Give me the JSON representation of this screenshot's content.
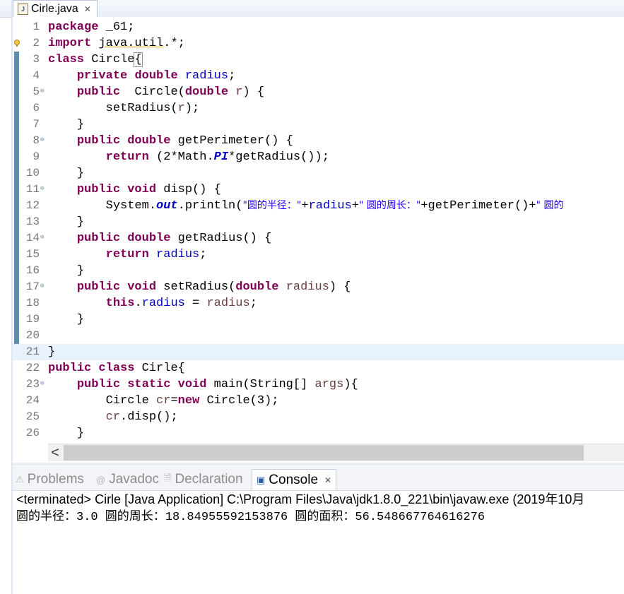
{
  "editor_tab": {
    "title": "Cirle.java",
    "icon": "java-file-icon"
  },
  "code_lines": [
    [
      {
        "t": "package",
        "c": "kw"
      },
      {
        "t": " _61;"
      }
    ],
    [
      {
        "t": "import",
        "c": "kw"
      },
      {
        "t": " "
      },
      {
        "t": "java.util",
        "c": "underline"
      },
      {
        "t": ".*;"
      }
    ],
    [
      {
        "t": "class",
        "c": "kw"
      },
      {
        "t": " Circle"
      },
      {
        "t": "{",
        "c": "bracket-box"
      }
    ],
    [
      {
        "t": "    "
      },
      {
        "t": "private",
        "c": "kw"
      },
      {
        "t": " "
      },
      {
        "t": "double",
        "c": "kw"
      },
      {
        "t": " "
      },
      {
        "t": "radius",
        "c": "fld"
      },
      {
        "t": ";"
      }
    ],
    [
      {
        "t": "    "
      },
      {
        "t": "public",
        "c": "kw"
      },
      {
        "t": "  Circle("
      },
      {
        "t": "double",
        "c": "kw"
      },
      {
        "t": " "
      },
      {
        "t": "r",
        "c": "var"
      },
      {
        "t": ") {"
      }
    ],
    [
      {
        "t": "        setRadius("
      },
      {
        "t": "r",
        "c": "var"
      },
      {
        "t": ");"
      }
    ],
    [
      {
        "t": "    }"
      }
    ],
    [
      {
        "t": "    "
      },
      {
        "t": "public",
        "c": "kw"
      },
      {
        "t": " "
      },
      {
        "t": "double",
        "c": "kw"
      },
      {
        "t": " getPerimeter() {"
      }
    ],
    [
      {
        "t": "        "
      },
      {
        "t": "return",
        "c": "kw"
      },
      {
        "t": " (2*Math."
      },
      {
        "t": "PI",
        "c": "sfld"
      },
      {
        "t": "*getRadius());"
      }
    ],
    [
      {
        "t": "    }"
      }
    ],
    [
      {
        "t": "    "
      },
      {
        "t": "public",
        "c": "kw"
      },
      {
        "t": " "
      },
      {
        "t": "void",
        "c": "kw"
      },
      {
        "t": " disp() {"
      }
    ],
    [
      {
        "t": "        System."
      },
      {
        "t": "out",
        "c": "sfld"
      },
      {
        "t": ".println("
      },
      {
        "t": "\"圆的半径：\"",
        "c": "str cjk"
      },
      {
        "t": "+"
      },
      {
        "t": "radius",
        "c": "fld"
      },
      {
        "t": "+"
      },
      {
        "t": "\" 圆的周长：\"",
        "c": "str cjk"
      },
      {
        "t": "+getPerimeter()+"
      },
      {
        "t": "\" 圆的",
        "c": "str cjk"
      }
    ],
    [
      {
        "t": "    }"
      }
    ],
    [
      {
        "t": "    "
      },
      {
        "t": "public",
        "c": "kw"
      },
      {
        "t": " "
      },
      {
        "t": "double",
        "c": "kw"
      },
      {
        "t": " getRadius() {"
      }
    ],
    [
      {
        "t": "        "
      },
      {
        "t": "return",
        "c": "kw"
      },
      {
        "t": " "
      },
      {
        "t": "radius",
        "c": "fld"
      },
      {
        "t": ";"
      }
    ],
    [
      {
        "t": "    }"
      }
    ],
    [
      {
        "t": "    "
      },
      {
        "t": "public",
        "c": "kw"
      },
      {
        "t": " "
      },
      {
        "t": "void",
        "c": "kw"
      },
      {
        "t": " setRadius("
      },
      {
        "t": "double",
        "c": "kw"
      },
      {
        "t": " "
      },
      {
        "t": "radius",
        "c": "var"
      },
      {
        "t": ") {"
      }
    ],
    [
      {
        "t": "        "
      },
      {
        "t": "this",
        "c": "kw"
      },
      {
        "t": "."
      },
      {
        "t": "radius",
        "c": "fld"
      },
      {
        "t": " = "
      },
      {
        "t": "radius",
        "c": "var"
      },
      {
        "t": ";"
      }
    ],
    [
      {
        "t": "    }"
      }
    ],
    [
      {
        "t": ""
      }
    ],
    [
      {
        "t": "}"
      }
    ],
    [
      {
        "t": "public",
        "c": "kw"
      },
      {
        "t": " "
      },
      {
        "t": "class",
        "c": "kw"
      },
      {
        "t": " Cirle{"
      }
    ],
    [
      {
        "t": "    "
      },
      {
        "t": "public",
        "c": "kw"
      },
      {
        "t": " "
      },
      {
        "t": "static",
        "c": "kw"
      },
      {
        "t": " "
      },
      {
        "t": "void",
        "c": "kw"
      },
      {
        "t": " main(String[] "
      },
      {
        "t": "args",
        "c": "var"
      },
      {
        "t": "){"
      }
    ],
    [
      {
        "t": "        Circle "
      },
      {
        "t": "cr",
        "c": "var"
      },
      {
        "t": "="
      },
      {
        "t": "new",
        "c": "kw"
      },
      {
        "t": " Circle(3);"
      }
    ],
    [
      {
        "t": "        "
      },
      {
        "t": "cr",
        "c": "var"
      },
      {
        "t": ".disp();"
      }
    ],
    [
      {
        "t": "    }"
      }
    ]
  ],
  "line_numbers": [
    "1",
    "2",
    "3",
    "4",
    "5",
    "6",
    "7",
    "8",
    "9",
    "10",
    "11",
    "12",
    "13",
    "14",
    "15",
    "16",
    "17",
    "18",
    "19",
    "20",
    "21",
    "22",
    "23",
    "24",
    "25",
    "26"
  ],
  "fold_lines": [
    5,
    8,
    11,
    14,
    17,
    23
  ],
  "current_line": 21,
  "warning_line": 2,
  "scrollbar": {
    "left_arrow": "<"
  },
  "panel_tabs": [
    {
      "label": "Problems",
      "icon": "problems-icon",
      "glyph": "⚠",
      "active": false
    },
    {
      "label": "Javadoc",
      "icon": "javadoc-icon",
      "glyph": "@",
      "active": false
    },
    {
      "label": "Declaration",
      "icon": "declaration-icon",
      "glyph": "🗎",
      "active": false
    },
    {
      "label": "Console",
      "icon": "console-icon",
      "glyph": "▣",
      "active": true
    }
  ],
  "console": {
    "status": "<terminated> Cirle [Java Application] C:\\Program Files\\Java\\jdk1.8.0_221\\bin\\javaw.exe (2019年10月",
    "output": "圆的半径：3.0 圆的周长：18.84955592153876 圆的面积：56.548667764616276"
  },
  "colors": {
    "keyword": "#7f0055",
    "field": "#0000c0",
    "local_var": "#6a3e3e",
    "string": "#2a00ff",
    "line_number": "#787878",
    "current_line": "#e8f2fe"
  }
}
